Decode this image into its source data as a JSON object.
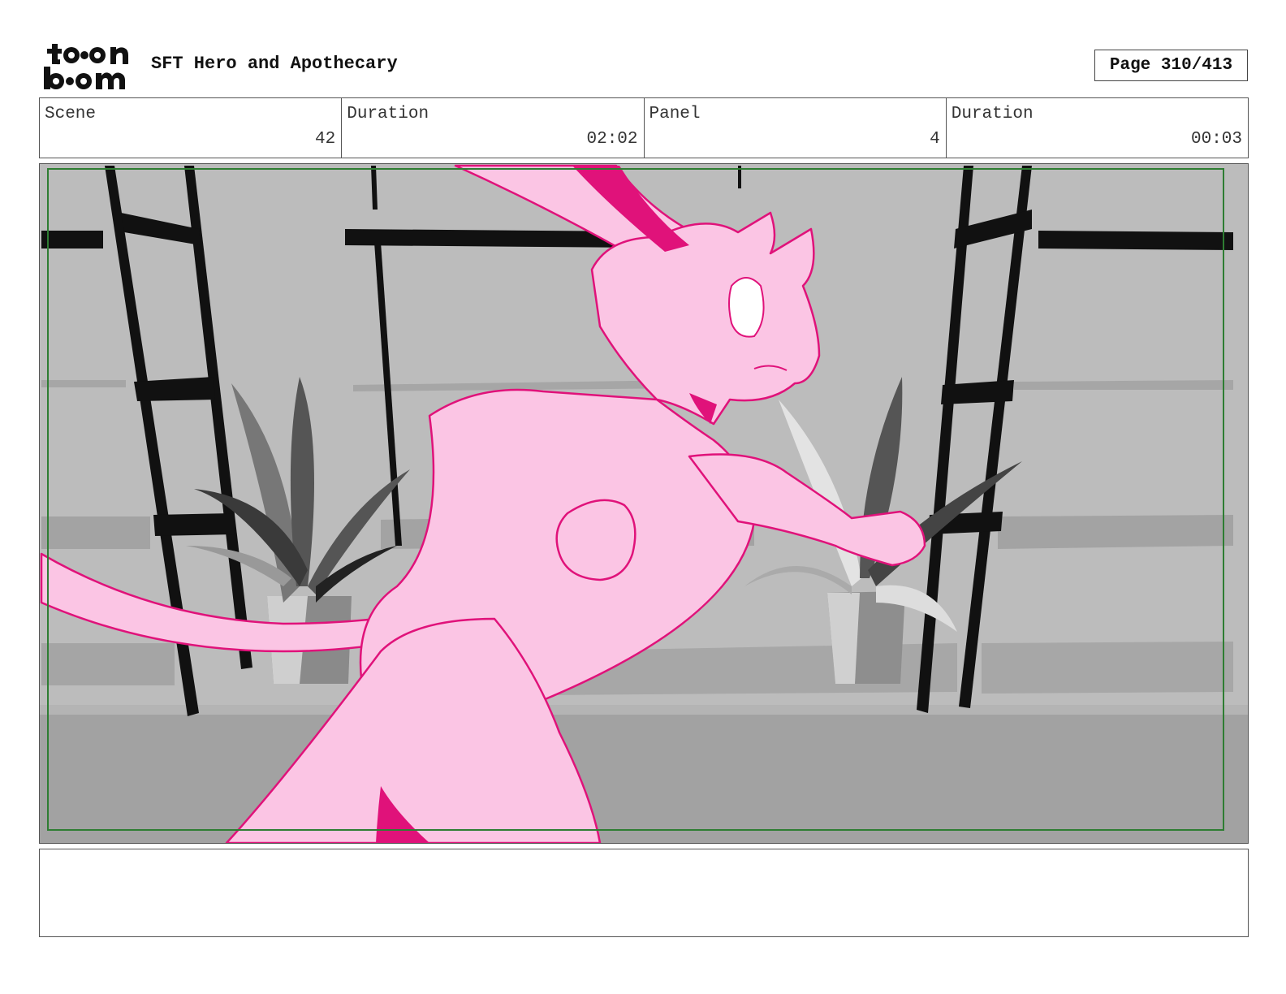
{
  "header": {
    "logo_text": "toonboom",
    "project_title": "SFT Hero and Apothecary",
    "page_label": "Page 310/413"
  },
  "info": {
    "scene_label": "Scene",
    "scene_value": "42",
    "scene_duration_label": "Duration",
    "scene_duration_value": "02:02",
    "panel_label": "Panel",
    "panel_value": "4",
    "panel_duration_label": "Duration",
    "panel_duration_value": "00:03"
  },
  "notes": {
    "text": ""
  },
  "colors": {
    "character_fill": "#fbc5e4",
    "character_line": "#e0127a",
    "safe_frame": "#2e7d32",
    "background_wall": "#bdbdbd",
    "floor": "#a3a3a3"
  }
}
